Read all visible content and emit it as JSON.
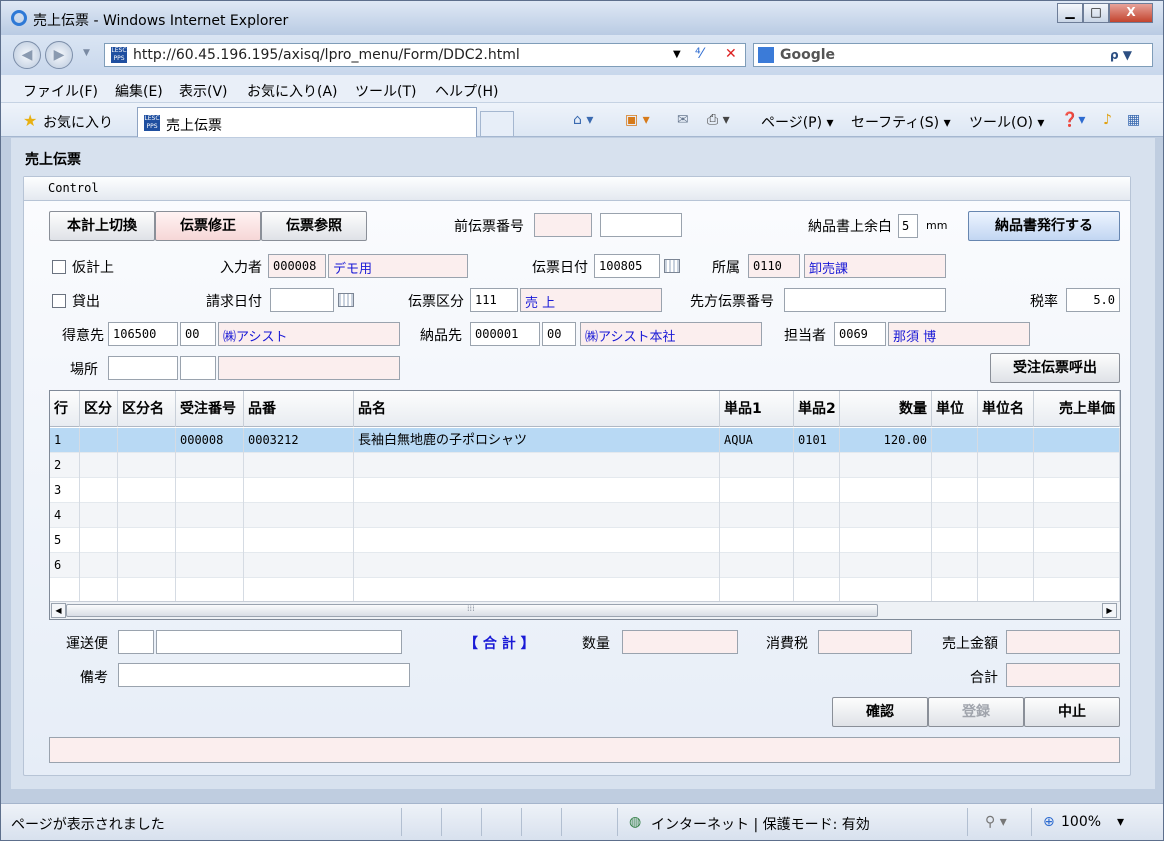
{
  "window": {
    "title": "売上伝票 - Windows Internet Explorer",
    "min_glyph": "▁",
    "max_glyph": "□",
    "close_glyph": "X"
  },
  "address_bar": {
    "url": "http://60.45.196.195/axisq/lpro_menu/Form/DDC2.html",
    "search_label": "Google",
    "back_glyph": "◀",
    "forward_glyph": "▶",
    "dropdown_glyph": "▼",
    "refresh_glyph": "⁴⁄",
    "stop_glyph": "✕",
    "search_glyph": "ρ ▼"
  },
  "menu": {
    "file": "ファイル(F)",
    "edit": "編集(E)",
    "view": "表示(V)",
    "favorites": "お気に入り(A)",
    "tools": "ツール(T)",
    "help": "ヘルプ(H)"
  },
  "favorites_bar": {
    "star_glyph": "★",
    "favorites_label": "お気に入り",
    "tab_title": "売上伝票",
    "favicon_text": "LESC PPS"
  },
  "command_bar": {
    "home_glyph": "⌂ ▾",
    "feeds_glyph": "▣ ▾",
    "mail_glyph": "✉",
    "print_glyph": "⎙ ▾",
    "page": "ページ(P) ▾",
    "safety": "セーフティ(S) ▾",
    "tools": "ツール(O) ▾",
    "help_glyph": "❓▾",
    "research_glyph": "♪",
    "extra_glyph": "▦"
  },
  "page": {
    "title": "売上伝票",
    "panel_title": "Control"
  },
  "buttons": {
    "switch_posting": "本計上切換",
    "fix_slip": "伝票修正",
    "view_slip": "伝票参照",
    "issue_delivery": "納品書発行する",
    "call_order": "受注伝票呼出",
    "confirm": "確認",
    "register": "登録",
    "cancel": "中止"
  },
  "form": {
    "prev_slip_label": "前伝票番号",
    "prev_slip_a": "",
    "prev_slip_b": "",
    "margin_label": "納品書上余白",
    "margin_value": "5",
    "margin_unit": "mm",
    "provisional_label": "仮計上",
    "lending_label": "貸出",
    "inputter_label": "入力者",
    "inputter_code": "000008",
    "inputter_name": "デモ用",
    "slip_date_label": "伝票日付",
    "slip_date": "100805",
    "dept_label": "所属",
    "dept_code": "0110",
    "dept_name": "卸売課",
    "billing_date_label": "請求日付",
    "billing_date": "",
    "slip_type_label": "伝票区分",
    "slip_type_code": "111",
    "slip_type_name": "売 上",
    "partner_slip_label": "先方伝票番号",
    "partner_slip": "",
    "tax_label": "税率",
    "tax_rate": "5.0",
    "customer_label": "得意先",
    "customer_code": "106500",
    "customer_sub": "00",
    "customer_name": "㈱アシスト",
    "delivery_label": "納品先",
    "delivery_code": "000001",
    "delivery_sub": "00",
    "delivery_name": "㈱アシスト本社",
    "staff_label": "担当者",
    "staff_code": "0069",
    "staff_name": "那須 博",
    "location_label": "場所",
    "location_a": "",
    "location_b": "",
    "location_c": ""
  },
  "grid": {
    "columns": [
      "行",
      "区分",
      "区分名",
      "受注番号",
      "品番",
      "品名",
      "単品1",
      "単品2",
      "数量",
      "単位",
      "単位名",
      "売上単価"
    ],
    "rows": [
      [
        "1",
        "",
        "",
        "000008",
        "0003212",
        "長袖白無地鹿の子ポロシャツ",
        "AQUA",
        "0101",
        "120.00",
        "",
        "",
        ""
      ],
      [
        "2",
        "",
        "",
        "",
        "",
        "",
        "",
        "",
        "",
        "",
        "",
        ""
      ],
      [
        "3",
        "",
        "",
        "",
        "",
        "",
        "",
        "",
        "",
        "",
        "",
        ""
      ],
      [
        "4",
        "",
        "",
        "",
        "",
        "",
        "",
        "",
        "",
        "",
        "",
        ""
      ],
      [
        "5",
        "",
        "",
        "",
        "",
        "",
        "",
        "",
        "",
        "",
        "",
        ""
      ],
      [
        "6",
        "",
        "",
        "",
        "",
        "",
        "",
        "",
        "",
        "",
        "",
        ""
      ],
      [
        "",
        "",
        "",
        "",
        "",
        "",
        "",
        "",
        "",
        "",
        "",
        ""
      ]
    ],
    "scroll_left_glyph": "◀",
    "scroll_right_glyph": "▶",
    "scroll_grip": "⁞⁞⁞"
  },
  "footer": {
    "shipping_label": "運送便",
    "shipping_code": "",
    "shipping_name": "",
    "total_marker": "【 合 計 】",
    "qty_label": "数量",
    "qty_value": "",
    "consumption_tax_label": "消費税",
    "consumption_tax_value": "",
    "sales_amount_label": "売上金額",
    "sales_amount_value": "",
    "remarks_label": "備考",
    "remarks_value": "",
    "sum_label": "合計",
    "sum_value": "",
    "message": ""
  },
  "statusbar": {
    "message": "ページが表示されました",
    "zone": "インターネット | 保護モード: 有効",
    "globe_glyph": "◍",
    "lock_glyph": "⚲ ▾",
    "zoom": "100%",
    "zoom_glyph": "⊕",
    "zoom_dropdown": "▾"
  },
  "colors": {
    "selected_row": "#b8d9f4",
    "readonly_field": "#fbeeee",
    "link_text": "#1a1ad6",
    "total_marker": "#1a1ad6"
  }
}
